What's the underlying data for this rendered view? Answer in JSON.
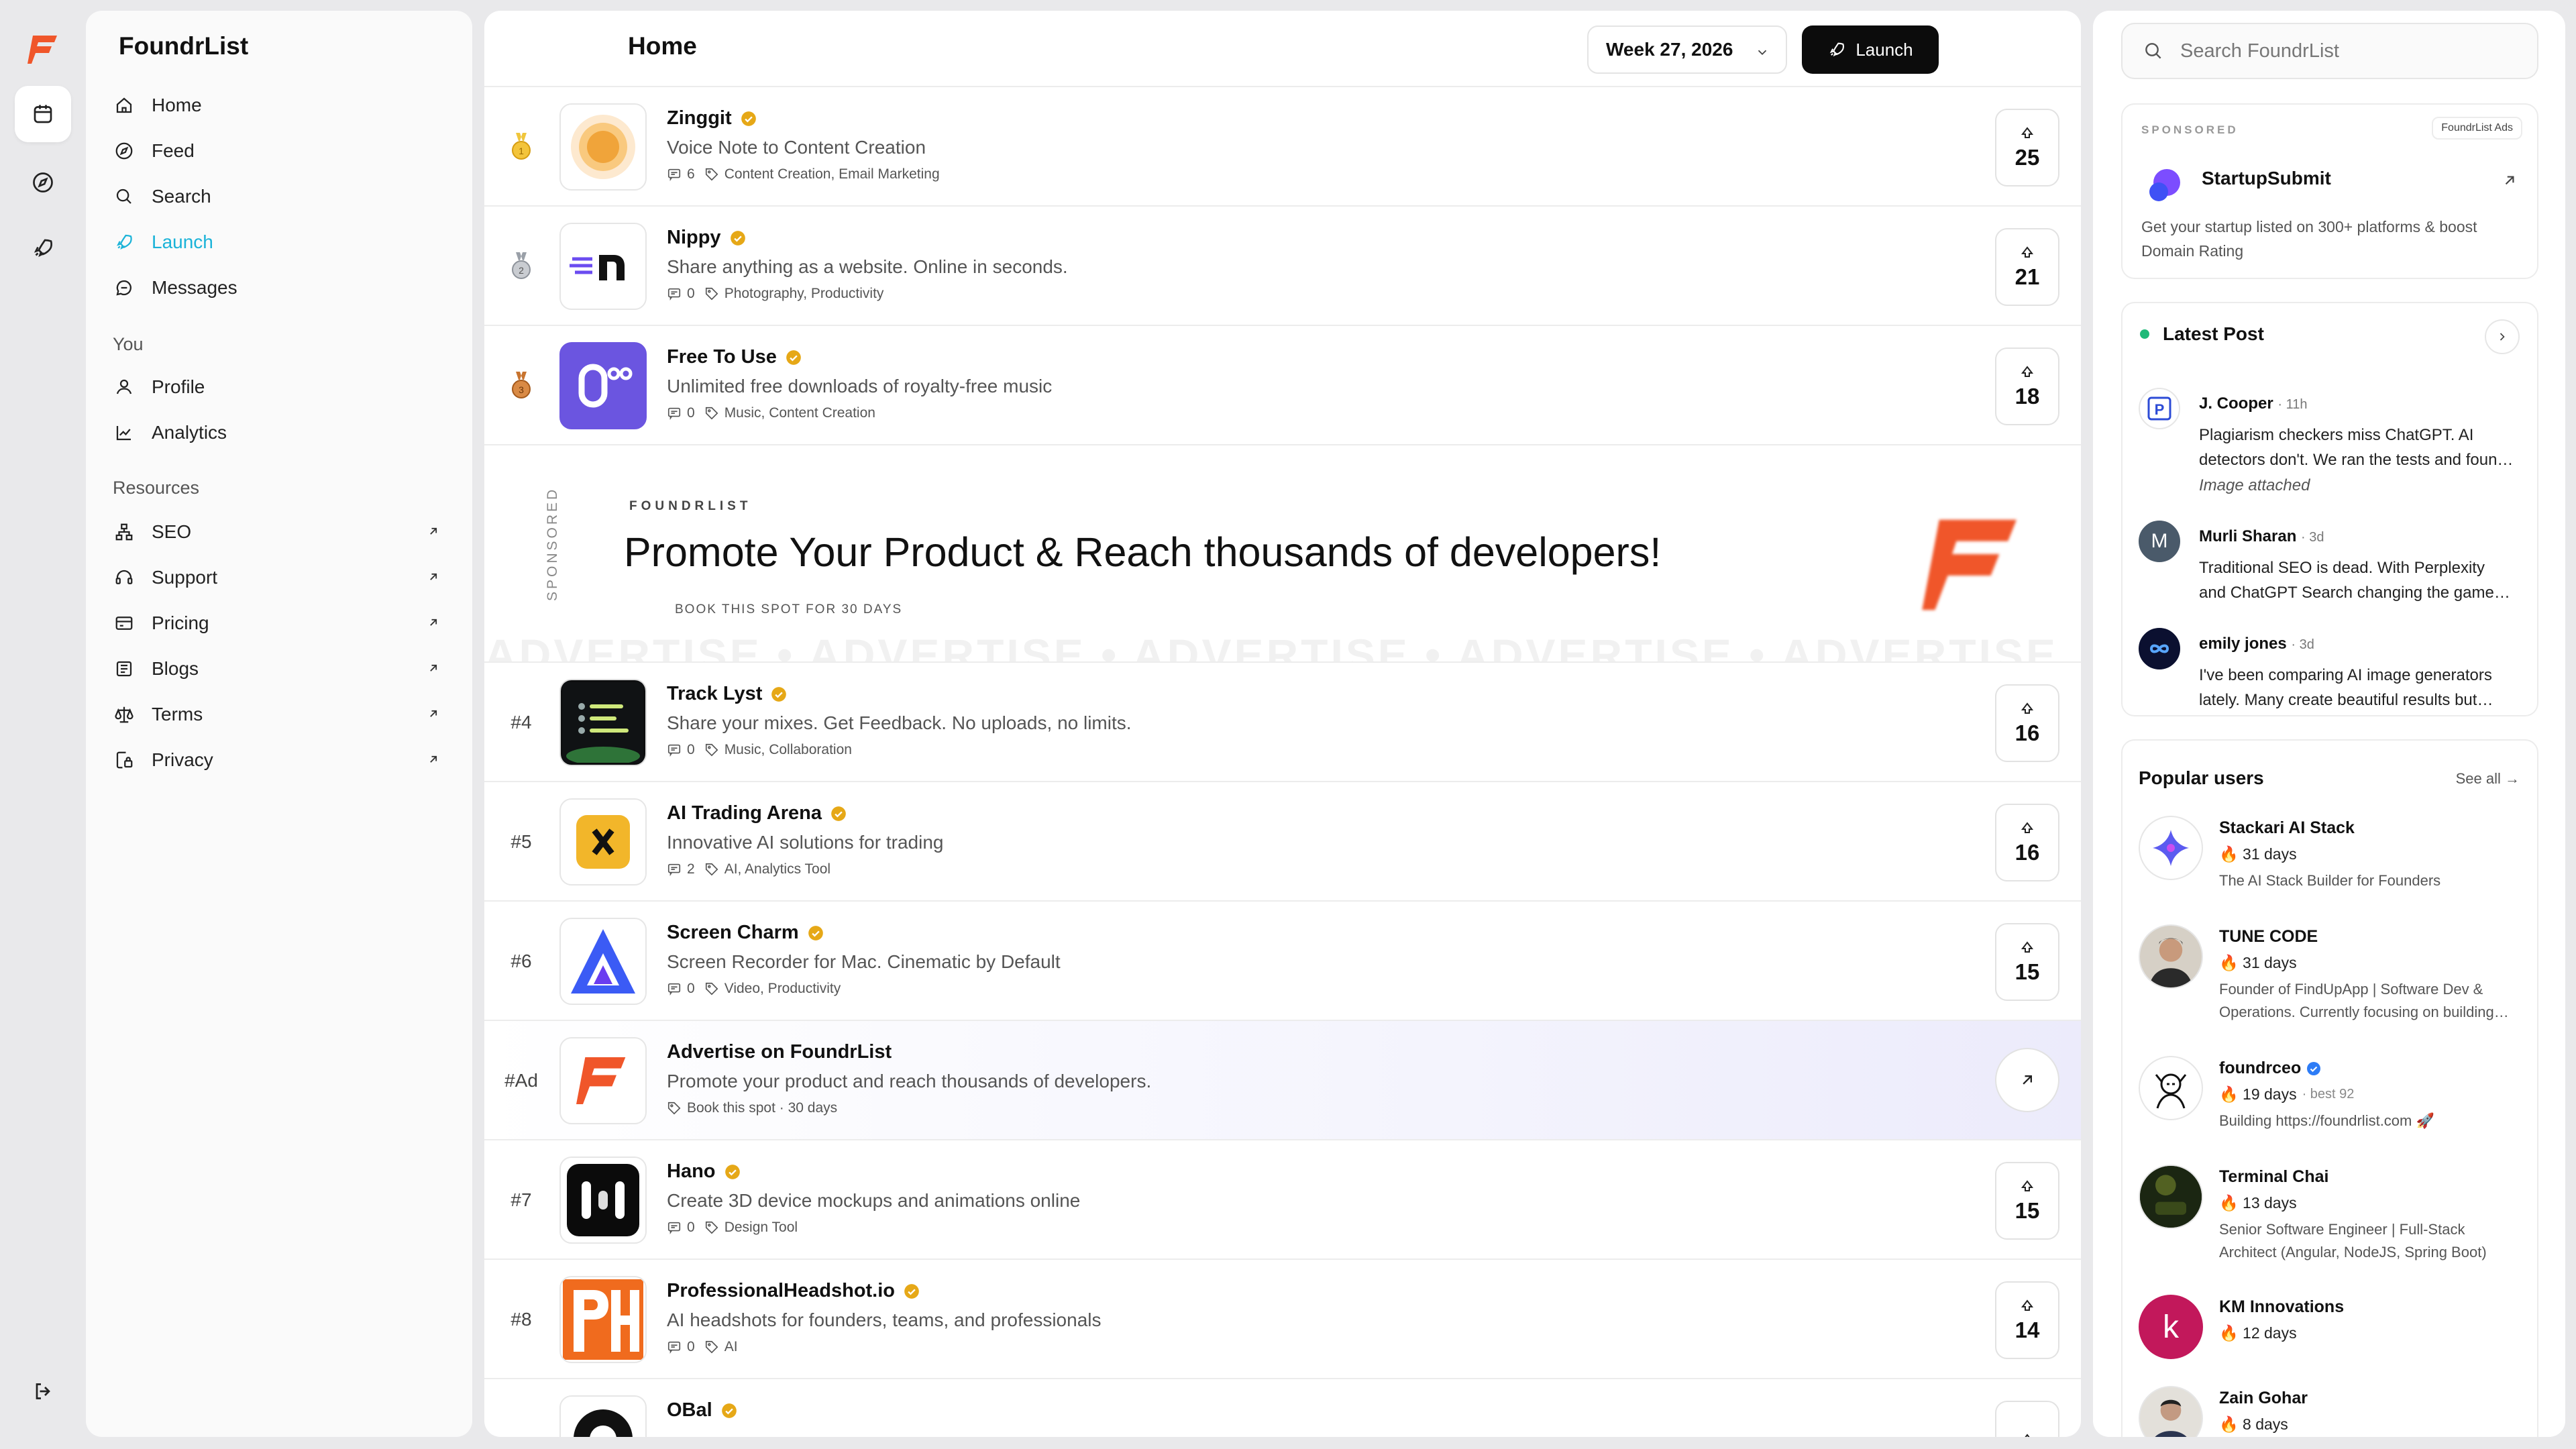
{
  "app": {
    "brand": "FoundrList"
  },
  "sidebar": {
    "items": [
      {
        "label": "Home"
      },
      {
        "label": "Feed"
      },
      {
        "label": "Search"
      },
      {
        "label": "Launch"
      },
      {
        "label": "Messages"
      }
    ],
    "you_heading": "You",
    "you_items": [
      {
        "label": "Profile"
      },
      {
        "label": "Analytics"
      }
    ],
    "resources_heading": "Resources",
    "resources": [
      {
        "label": "SEO"
      },
      {
        "label": "Support"
      },
      {
        "label": "Pricing"
      },
      {
        "label": "Blogs"
      },
      {
        "label": "Terms"
      },
      {
        "label": "Privacy"
      }
    ]
  },
  "header": {
    "title": "Home",
    "week": "Week 27, 2026",
    "launch_label": "Launch"
  },
  "products": [
    {
      "rank": "",
      "name": "Zinggit",
      "desc": "Voice Note to Content Creation",
      "comments": "6",
      "tags": "Content Creation, Email Marketing",
      "votes": "25"
    },
    {
      "rank": "",
      "name": "Nippy",
      "desc": "Share anything as a website. Online in seconds.",
      "comments": "0",
      "tags": "Photography, Productivity",
      "votes": "21"
    },
    {
      "rank": "",
      "name": "Free To Use",
      "desc": "Unlimited free downloads of royalty-free music",
      "comments": "0",
      "tags": "Music, Content Creation",
      "votes": "18"
    },
    {
      "rank": "#4",
      "name": "Track Lyst",
      "desc": "Share your mixes. Get Feedback. No uploads, no limits.",
      "comments": "0",
      "tags": "Music, Collaboration",
      "votes": "16"
    },
    {
      "rank": "#5",
      "name": "AI Trading Arena",
      "desc": "Innovative AI solutions for trading",
      "comments": "2",
      "tags": "AI, Analytics Tool",
      "votes": "16"
    },
    {
      "rank": "#6",
      "name": "Screen Charm",
      "desc": "Screen Recorder for Mac. Cinematic by Default",
      "comments": "0",
      "tags": "Video, Productivity",
      "votes": "15"
    },
    {
      "rank": "#7",
      "name": "Hano",
      "desc": "Create 3D device mockups and animations online",
      "comments": "0",
      "tags": "Design Tool",
      "votes": "15"
    },
    {
      "rank": "#8",
      "name": "ProfessionalHeadshot.io",
      "desc": "AI headshots for founders, teams, and professionals",
      "comments": "0",
      "tags": "AI",
      "votes": "14"
    },
    {
      "rank": "",
      "name": "OBal"
    }
  ],
  "ad_row": {
    "rank": "#Ad",
    "name": "Advertise on FoundrList",
    "desc": "Promote your product and reach thousands of developers.",
    "meta": "Book this spot · 30 days"
  },
  "promo": {
    "sponsored": "SPONSORED",
    "brand": "FOUNDRLIST",
    "headline": "Promote Your Product & Reach thousands of developers!",
    "book": "BOOK THIS SPOT FOR 30 DAYS",
    "watermark": "ADVERTISE • ADVERTISE • ADVERTISE • ADVERTISE • ADVERTISE"
  },
  "right": {
    "search_placeholder": "Search FoundrList",
    "sponsored": {
      "label": "SPONSORED",
      "badge": "FoundrList Ads",
      "name": "StartupSubmit",
      "desc": "Get your startup listed on 300+ platforms & boost Domain Rating"
    },
    "latest": {
      "title": "Latest Post",
      "posts": [
        {
          "author": "J. Cooper",
          "time": "· 11h",
          "text": "Plagiarism checkers miss ChatGPT. AI detectors don't. We ran the tests and found out which tools actually work.",
          "attachment": "Image attached"
        },
        {
          "author": "Murli Sharan",
          "time": "· 3d",
          "text": "Traditional SEO is dead. With Perplexity and ChatGPT Search changing the game for everyone.",
          "initial": "M"
        },
        {
          "author": "emily jones",
          "time": "· 3d",
          "text": "I've been comparing AI image generators lately. Many create beautiful results but differ a lot."
        }
      ]
    },
    "popular": {
      "title": "Popular users",
      "see_all": "See all →",
      "users": [
        {
          "name": "Stackari AI Stack",
          "streak": "31 days",
          "best": "",
          "bio": "The AI Stack Builder for Founders"
        },
        {
          "name": "TUNE CODE",
          "streak": "31 days",
          "best": "",
          "bio": "Founder of FindUpApp | Software Dev & Operations. Currently focusing on building products."
        },
        {
          "name": "foundrceo",
          "streak": "19 days",
          "best": "· best 92",
          "bio": "Building https://foundrlist.com 🚀"
        },
        {
          "name": "Terminal Chai",
          "streak": "13 days",
          "best": "",
          "bio": "Senior Software Engineer | Full-Stack Architect (Angular, NodeJS, Spring Boot)"
        },
        {
          "name": "KM Innovations",
          "streak": "12 days",
          "best": "",
          "bio": "",
          "initial": "k"
        },
        {
          "name": "Zain Gohar",
          "streak": "8 days",
          "best": "",
          "bio": ""
        }
      ]
    }
  },
  "colors": {
    "brand": "#f0562a",
    "accent": "#1bb3d8",
    "verified": "#e6a817",
    "live": "#1fb978"
  }
}
